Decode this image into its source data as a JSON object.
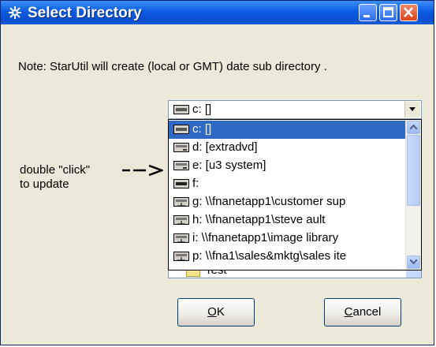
{
  "window": {
    "title": "Select Directory",
    "title_icon": "gear-icon"
  },
  "note": "Note: StarUtil will create (local or GMT) date sub directory .",
  "combo": {
    "value": "c: []"
  },
  "drives": [
    {
      "label": "c: []",
      "icon": "hard-drive-icon",
      "selected": true
    },
    {
      "label": "d: [extradvd]",
      "icon": "cd-drive-icon"
    },
    {
      "label": "e: [u3 system]",
      "icon": "cd-drive-icon"
    },
    {
      "label": "f:",
      "icon": "removable-drive-icon"
    },
    {
      "label": "g: \\\\fnanetapp1\\customer sup",
      "icon": "network-drive-icon"
    },
    {
      "label": "h: \\\\fnanetapp1\\steve ault",
      "icon": "network-drive-icon"
    },
    {
      "label": "i: \\\\fnanetapp1\\image library",
      "icon": "network-drive-icon"
    },
    {
      "label": "p: \\\\fna1\\sales&mktg\\sales ite",
      "icon": "network-drive-icon"
    }
  ],
  "folder_list_partial_item": "Test",
  "hint": {
    "line1": "double \"click\"",
    "line2": "to update"
  },
  "buttons": {
    "ok_prefix": "O",
    "ok_rest": "K",
    "cancel_prefix": "C",
    "cancel_rest": "ancel"
  }
}
